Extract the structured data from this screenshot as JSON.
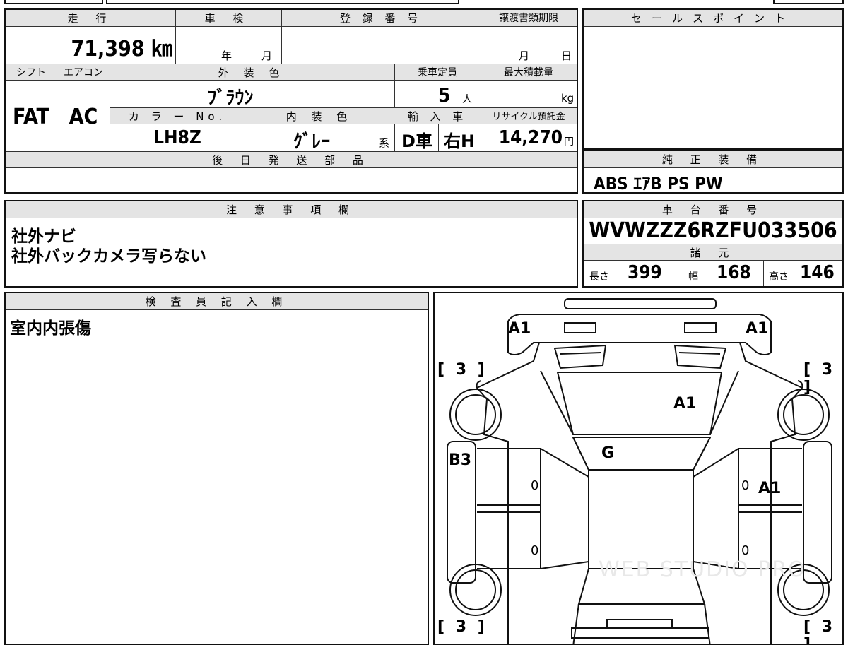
{
  "left_top": {
    "mileage_label": "走 行",
    "mileage_value": "71,398 ㎞",
    "shaken_label": "車 検",
    "shaken_year": "年",
    "shaken_month": "月",
    "reg_label": "登 録 番 号",
    "transfer_label": "譲渡書類期限",
    "transfer_month": "月",
    "transfer_day": "日",
    "shift_label": "シフト",
    "shift_value": "FAT",
    "ac_label": "エアコン",
    "ac_value": "AC",
    "ext_color_label": "外 装 色",
    "ext_color_value": "ﾌﾞﾗｳﾝ",
    "capacity_label": "乗車定員",
    "capacity_value": "5",
    "capacity_unit": "人",
    "load_label": "最大積載量",
    "load_unit": "kg",
    "color_no_label": "カ ラ ー No.",
    "color_no_value": "LH8Z",
    "int_color_label": "内 装 色",
    "int_color_value": "ｸﾞﾚｰ",
    "int_color_suffix": "系",
    "import_label": "輸 入 車",
    "import_value": "D車",
    "handle_value": "右H",
    "recycle_label": "リサイクル預託金",
    "recycle_value": "14,270",
    "recycle_unit": "円",
    "later_parts_label": "後 日 発 送 部 品"
  },
  "sale_point": {
    "label": "セールスポイント"
  },
  "equipment": {
    "label": "純 正 装 備",
    "value": "ABS ｴｱB PS PW"
  },
  "notes": {
    "label": "注 意 事 項 欄",
    "line1": "社外ナビ",
    "line2": "社外バックカメラ写らない"
  },
  "chassis": {
    "label": "車 台 番 号",
    "value": "WVWZZZ6RZFU033506",
    "spec_label": "諸 元",
    "length_label": "長さ",
    "length_value": "399",
    "width_label": "幅",
    "width_value": "168",
    "height_label": "高さ",
    "height_value": "146"
  },
  "inspector": {
    "label": "検 査 員 記 入 欄",
    "text": "室内内張傷"
  },
  "diagram": {
    "labels": {
      "front_left": "A1",
      "front_right": "A1",
      "hood": "A1",
      "windshield": "G",
      "left_rocker": "B3",
      "right_door": "A1",
      "door_fl": "0",
      "door_fr": "0",
      "door_rl": "0",
      "door_rr": "0",
      "tire_fl": "3",
      "tire_fr": "3",
      "tire_rl": "3",
      "tire_rr": "3"
    },
    "watermark": "WEB STUDIO PRO"
  }
}
